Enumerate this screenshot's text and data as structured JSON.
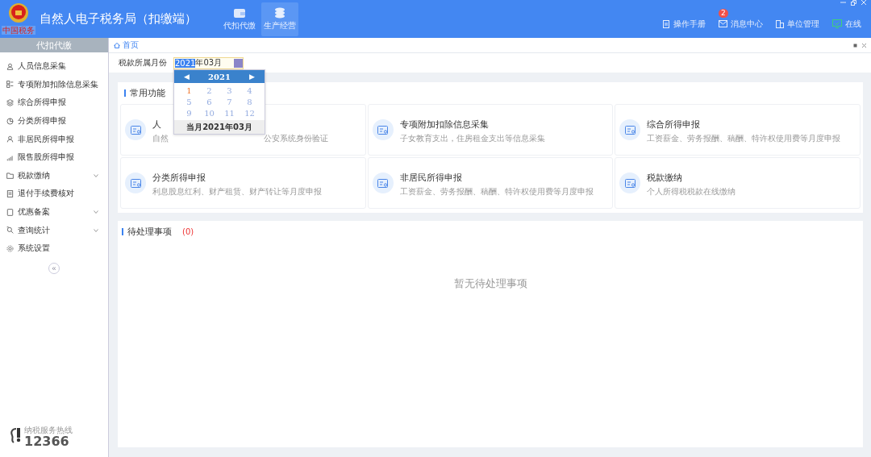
{
  "header": {
    "logo_caption": "中国税务",
    "title": "自然人电子税务局（扣缴端）",
    "modules": [
      {
        "label": "代扣代缴",
        "selected": false
      },
      {
        "label": "生产经营",
        "selected": true
      }
    ],
    "actions": [
      {
        "label": "操作手册",
        "kind": "manual"
      },
      {
        "label": "消息中心",
        "kind": "message",
        "badge": "2"
      },
      {
        "label": "单位管理",
        "kind": "org"
      },
      {
        "label": "在线",
        "kind": "online"
      }
    ]
  },
  "sidebar": {
    "title": "代扣代缴",
    "collapse": "«",
    "items": [
      {
        "label": "人员信息采集",
        "expandable": false
      },
      {
        "label": "专项附加扣除信息采集",
        "expandable": false
      },
      {
        "label": "综合所得申报",
        "expandable": false
      },
      {
        "label": "分类所得申报",
        "expandable": false
      },
      {
        "label": "非居民所得申报",
        "expandable": false
      },
      {
        "label": "限售股所得申报",
        "expandable": false
      },
      {
        "label": "税款缴纳",
        "expandable": true
      },
      {
        "label": "退付手续费核对",
        "expandable": false
      },
      {
        "label": "优惠备案",
        "expandable": true
      },
      {
        "label": "查询统计",
        "expandable": true
      },
      {
        "label": "系统设置",
        "expandable": false
      }
    ],
    "hotline": {
      "label": "纳税服务热线",
      "number": "12366"
    }
  },
  "breadcrumb": "首页",
  "filter": {
    "label": "税款所属月份",
    "value_selected": "2021",
    "value_rest": "年03月"
  },
  "month_picker": {
    "year": "2021",
    "prev": "◀",
    "next": "▶",
    "months": [
      {
        "label": "1",
        "selected": true
      },
      {
        "label": "2",
        "selected": false
      },
      {
        "label": "3",
        "selected": false
      },
      {
        "label": "4",
        "selected": false
      },
      {
        "label": "5",
        "selected": false
      },
      {
        "label": "6",
        "selected": false
      },
      {
        "label": "7",
        "selected": false
      },
      {
        "label": "8",
        "selected": false
      },
      {
        "label": "9",
        "selected": false
      },
      {
        "label": "10",
        "selected": false
      },
      {
        "label": "11",
        "selected": false
      },
      {
        "label": "12",
        "selected": false
      }
    ],
    "footer": "当月2021年03月"
  },
  "common": {
    "title": "常用功能",
    "cards": [
      {
        "title": "人",
        "desc_start": "自然",
        "desc_end": "公安系统身份验证"
      },
      {
        "title": "专项附加扣除信息采集",
        "desc_start": "子女教育支出，住房租金支出等信息采集"
      },
      {
        "title": "综合所得申报",
        "desc_start": "工资薪金、劳务报酬、稿酬、特许权使用费等月度申报"
      },
      {
        "title": "分类所得申报",
        "desc_start": "利息股息红利、财产租赁、财产转让等月度申报"
      },
      {
        "title": "非居民所得申报",
        "desc_start": "工资薪金、劳务报酬、稿酬、特许权使用费等月度申报"
      },
      {
        "title": "税款缴纳",
        "desc_start": "个人所得税税款在线缴纳"
      }
    ]
  },
  "pending": {
    "title": "待处理事项",
    "count": "(0)",
    "empty": "暂无待处理事项"
  }
}
